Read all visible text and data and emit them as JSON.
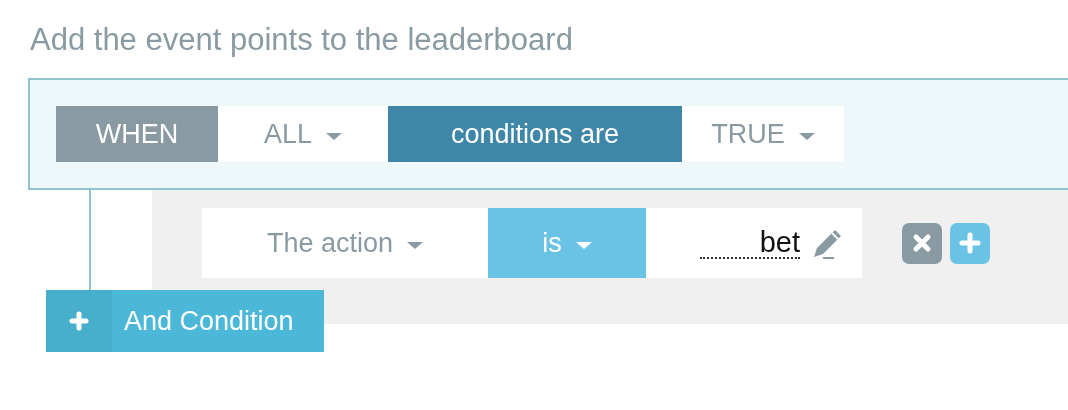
{
  "title": "Add the event points to the leaderboard",
  "when_bar": {
    "label": "WHEN",
    "quantifier": {
      "value": "ALL"
    },
    "connector": "conditions are",
    "result": {
      "value": "TRUE"
    }
  },
  "conditions": [
    {
      "field": {
        "value": "The action"
      },
      "operator": {
        "value": "is"
      },
      "value": "bet"
    }
  ],
  "add_button": {
    "label": "And Condition"
  }
}
